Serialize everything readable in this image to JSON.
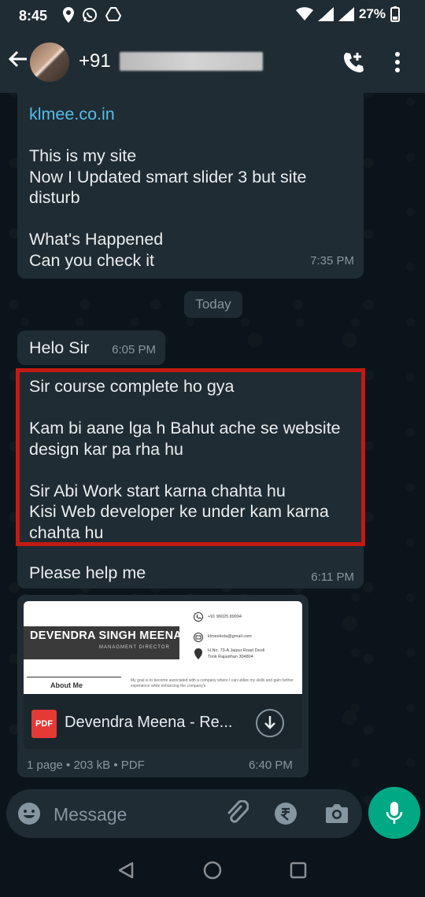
{
  "status_bar": {
    "time": "8:45",
    "battery": "27%"
  },
  "header": {
    "phone_prefix": "+91",
    "icons": [
      "back-arrow-icon",
      "add-call-icon",
      "more-options-icon"
    ]
  },
  "messages": [
    {
      "link": "klmee.co.in",
      "lines": [
        "This is my site",
        "Now I Updated smart slider 3 but site",
        "disturb",
        "",
        "What's Happened",
        "Can you check it"
      ],
      "time": "7:35 PM"
    }
  ],
  "date_chip": "Today",
  "msg_helo": {
    "text": "Helo Sir",
    "time": "6:05 PM"
  },
  "msg_course": {
    "lines": [
      "Sir course complete ho gya",
      "",
      "Kam bi aane lga h Bahut ache se website",
      "design kar pa rha hu",
      "",
      "Sir Abi Work start karna chahta hu",
      "Kisi Web developer ke under kam karna",
      "chahta hu"
    ]
  },
  "msg_help": {
    "text": "Please help me",
    "time": "6:11 PM"
  },
  "document": {
    "preview": {
      "name": "DEVENDRA SINGH MEENA",
      "subtitle": "MANAGMENT DIRECTOR",
      "phone": "+91 96025 89994",
      "email": "klmeekota@gmail.com",
      "address_1": "H.No. 73-A Jaipur Road Deoli",
      "address_2": "Tonk Rajasthan 304804",
      "about": "About Me",
      "about_text": "My goal is to become associated with a company where I can utilize my skills and gain further experience while enhancing the company's"
    },
    "icon_label": "PDF",
    "file_name": "Devendra Meena - Re...",
    "meta": "1 page • 203 kB • PDF",
    "time": "6:40 PM"
  },
  "input": {
    "placeholder": "Message"
  },
  "colors": {
    "background": "#0b141a",
    "bubble": "#202c33",
    "header": "#1f2c34",
    "accent": "#00a884",
    "link": "#53bdeb",
    "highlight_border": "#c21a12"
  }
}
